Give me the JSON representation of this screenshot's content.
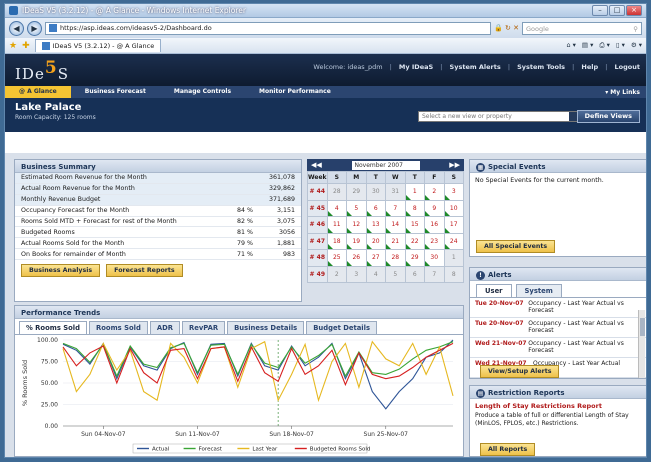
{
  "browser": {
    "title": "IDeaS V5 (3.2.12) - @ A Glance - Windows Internet Explorer",
    "url": "https://asp.ideas.com/ideasv5-2/Dashboard.do",
    "search_placeholder": "Google",
    "tab_label": "IDeaS V5 (3.2.12) - @ A Glance"
  },
  "app": {
    "logo": "IDe",
    "logo_mark": "5",
    "welcome": "Welcome: ideas_pdm",
    "top_links": [
      "My IDeaS",
      "System Alerts",
      "System Tools",
      "Help",
      "Logout"
    ],
    "menu": [
      "@ A Glance",
      "Business Forecast",
      "Manage Controls",
      "Monitor Performance"
    ],
    "my_links": "▾ My Links",
    "property_name": "Lake Palace",
    "property_capacity": "Room Capacity: 125 rooms",
    "view_select_placeholder": "Select a new view or property",
    "define_views": "Define Views"
  },
  "business_summary": {
    "title": "Business Summary",
    "rows": [
      {
        "label": "Estimated Room Revenue for the Month",
        "pct": "",
        "value": "361,078"
      },
      {
        "label": "Actual Room Revenue for the Month",
        "pct": "",
        "value": "329,862"
      },
      {
        "label": "Monthly Revenue Budget",
        "pct": "",
        "value": "371,689"
      },
      {
        "label": "Occupancy Forecast for the Month",
        "pct": "84 %",
        "value": "3,151"
      },
      {
        "label": "Rooms Sold MTD + Forecast for rest of the Month",
        "pct": "82 %",
        "value": "3,075"
      },
      {
        "label": "Budgeted Rooms",
        "pct": "81 %",
        "value": "3056"
      },
      {
        "label": "Actual Rooms Sold for the Month",
        "pct": "79 %",
        "value": "1,881"
      },
      {
        "label": "On Books for remainder of Month",
        "pct": "71 %",
        "value": "983"
      }
    ],
    "btn_analysis": "Business Analysis",
    "btn_forecast": "Forecast Reports"
  },
  "calendar": {
    "month": "November 2007",
    "headers": [
      "Week",
      "S",
      "M",
      "T",
      "W",
      "T",
      "F",
      "S"
    ],
    "weeks": [
      {
        "wk": "# 44",
        "days": [
          "28",
          "29",
          "30",
          "31",
          "1",
          "2",
          "3"
        ],
        "red": [
          4,
          5,
          6
        ]
      },
      {
        "wk": "# 45",
        "days": [
          "4",
          "5",
          "6",
          "7",
          "8",
          "9",
          "10"
        ],
        "red": [
          0,
          1,
          2,
          3,
          4,
          5,
          6
        ]
      },
      {
        "wk": "# 46",
        "days": [
          "11",
          "12",
          "13",
          "14",
          "15",
          "16",
          "17"
        ],
        "red": [
          0,
          1,
          2,
          3,
          4,
          5,
          6
        ]
      },
      {
        "wk": "# 47",
        "days": [
          "18",
          "19",
          "20",
          "21",
          "22",
          "23",
          "24"
        ],
        "red": [
          0,
          1,
          2,
          3,
          4,
          5,
          6
        ]
      },
      {
        "wk": "# 48",
        "days": [
          "25",
          "26",
          "27",
          "28",
          "29",
          "30",
          "1"
        ],
        "red": [
          0,
          1,
          2,
          3,
          4,
          5
        ]
      },
      {
        "wk": "# 49",
        "days": [
          "2",
          "3",
          "4",
          "5",
          "6",
          "7",
          "8"
        ],
        "red": []
      }
    ]
  },
  "special_events": {
    "title": "Special Events",
    "text": "No Special Events for the current month.",
    "button": "All Special Events"
  },
  "alerts": {
    "title": "Alerts",
    "tab_user": "User",
    "tab_system": "System",
    "rows": [
      {
        "date": "Tue 20-Nov-07",
        "text": "Occupancy - Last Year Actual vs Forecast"
      },
      {
        "date": "Tue 20-Nov-07",
        "text": "Occupancy - Last Year Actual vs Forecast"
      },
      {
        "date": "Wed 21-Nov-07",
        "text": "Occupancy - Last Year Actual vs Forecast"
      },
      {
        "date": "Wed 21-Nov-07",
        "text": "Occupancy - Last Year Actual"
      }
    ],
    "button": "View/Setup Alerts"
  },
  "restriction_reports": {
    "title": "Restriction Reports",
    "link": "Length of Stay Restrictions Report",
    "text": "Produce a table of full or differential Length of Stay (MinLOS, FPLOS, etc.) Restrictions.",
    "button": "All Reports"
  },
  "performance": {
    "title": "Performance Trends",
    "tabs": [
      "% Rooms Sold",
      "Rooms Sold",
      "ADR",
      "RevPAR",
      "Business Details",
      "Budget Details"
    ]
  },
  "chart_data": {
    "type": "line",
    "ylabel": "% Rooms Sold",
    "ylim": [
      0,
      100
    ],
    "yticks": [
      "100.00",
      "75.00",
      "50.00",
      "25.00",
      "0.00"
    ],
    "xtick_labels": [
      "Sun 04-Nov-07",
      "Sun 11-Nov-07",
      "Sun 18-Nov-07",
      "Sun 25-Nov-07"
    ],
    "xtick_index": [
      3,
      10,
      17,
      24
    ],
    "x": [
      "1",
      "2",
      "3",
      "4",
      "5",
      "6",
      "7",
      "8",
      "9",
      "10",
      "11",
      "12",
      "13",
      "14",
      "15",
      "16",
      "17",
      "18",
      "19",
      "20",
      "21",
      "22",
      "23",
      "24",
      "25",
      "26",
      "27",
      "28",
      "29",
      "30"
    ],
    "series": [
      {
        "name": "Actual",
        "color": "#2f5597",
        "values": [
          95,
          88,
          72,
          96,
          55,
          92,
          70,
          65,
          90,
          97,
          60,
          95,
          96,
          58,
          96,
          70,
          65,
          93,
          70,
          80,
          96,
          55,
          85,
          40,
          20,
          40,
          55,
          80,
          85,
          100
        ]
      },
      {
        "name": "Forecast",
        "color": "#3aa535",
        "values": [
          96,
          90,
          74,
          95,
          58,
          93,
          72,
          68,
          91,
          96,
          62,
          94,
          95,
          60,
          95,
          73,
          68,
          92,
          73,
          82,
          95,
          58,
          86,
          62,
          60,
          66,
          78,
          88,
          92,
          98
        ]
      },
      {
        "name": "Last Year",
        "color": "#e6b820",
        "values": [
          90,
          40,
          60,
          96,
          65,
          88,
          40,
          30,
          96,
          80,
          50,
          90,
          92,
          45,
          90,
          98,
          30,
          60,
          95,
          30,
          75,
          96,
          45,
          98,
          78,
          70,
          96,
          60,
          92,
          35
        ]
      },
      {
        "name": "Budgeted Rooms Sold",
        "color": "#d62020",
        "values": [
          92,
          70,
          85,
          93,
          50,
          90,
          62,
          50,
          88,
          90,
          55,
          90,
          92,
          52,
          92,
          62,
          52,
          90,
          60,
          70,
          88,
          48,
          85,
          60,
          55,
          58,
          68,
          80,
          88,
          96
        ]
      }
    ],
    "legend_position": "bottom"
  }
}
